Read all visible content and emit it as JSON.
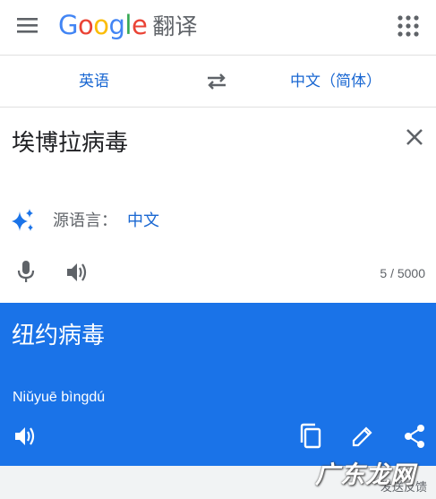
{
  "header": {
    "logo_letters": [
      "G",
      "o",
      "o",
      "g",
      "l",
      "e"
    ],
    "product": "翻译",
    "menu_icon": "hamburger-menu-icon",
    "apps_icon": "apps-grid-icon"
  },
  "language_bar": {
    "source": "英语",
    "target": "中文（简体）",
    "swap_icon": "swap-arrows-icon"
  },
  "input": {
    "text": "埃博拉病毒",
    "clear_icon": "close-icon",
    "detected_label": "源语言：",
    "detected_language": "中文",
    "char_count": "5 / 5000"
  },
  "result": {
    "text": "纽约病毒",
    "romanization": "Niǔyuē bìngdú"
  },
  "watermark": "广东龙网",
  "feedback": "发送反馈",
  "colors": {
    "accent": "#1a73e8",
    "link": "#1967d2",
    "text": "#202124",
    "muted": "#5f6368"
  }
}
